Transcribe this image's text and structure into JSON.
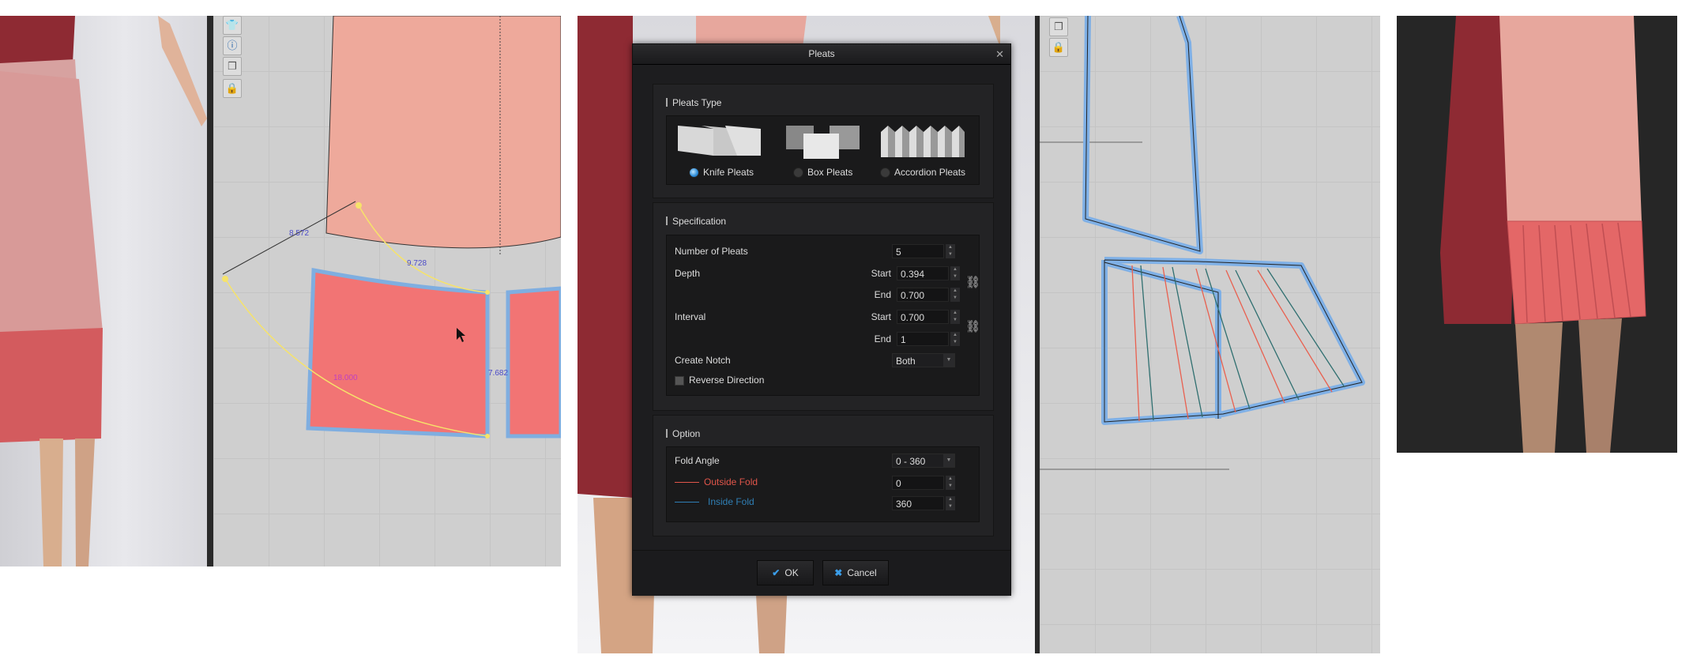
{
  "panel1": {
    "measurements": [
      "8.572",
      "9.728",
      "18.000",
      "7.682"
    ]
  },
  "dialog": {
    "title": "Pleats",
    "close_icon": "close-icon",
    "pleats_type": {
      "title": "Pleats Type",
      "options": [
        {
          "label": "Knife Pleats",
          "selected": true
        },
        {
          "label": "Box Pleats",
          "selected": false
        },
        {
          "label": "Accordion Pleats",
          "selected": false
        }
      ]
    },
    "specification": {
      "title": "Specification",
      "number_of_pleats_label": "Number of Pleats",
      "number_of_pleats": "5",
      "depth_label": "Depth",
      "depth_start_label": "Start",
      "depth_start": "0.394",
      "depth_end_label": "End",
      "depth_end": "0.700",
      "interval_label": "Interval",
      "interval_start_label": "Start",
      "interval_start": "0.700",
      "interval_end_label": "End",
      "interval_end": "1",
      "create_notch_label": "Create Notch",
      "create_notch": "Both",
      "reverse_direction_label": "Reverse Direction",
      "reverse_direction": false
    },
    "option": {
      "title": "Option",
      "fold_angle_label": "Fold Angle",
      "fold_angle": "0 - 360",
      "outside_fold_label": "Outside Fold",
      "outside_fold": "0",
      "inside_fold_label": "Inside Fold",
      "inside_fold": "360",
      "outside_color": "#e0554a",
      "inside_color": "#2f7fb5"
    },
    "ok_label": "OK",
    "cancel_label": "Cancel"
  }
}
